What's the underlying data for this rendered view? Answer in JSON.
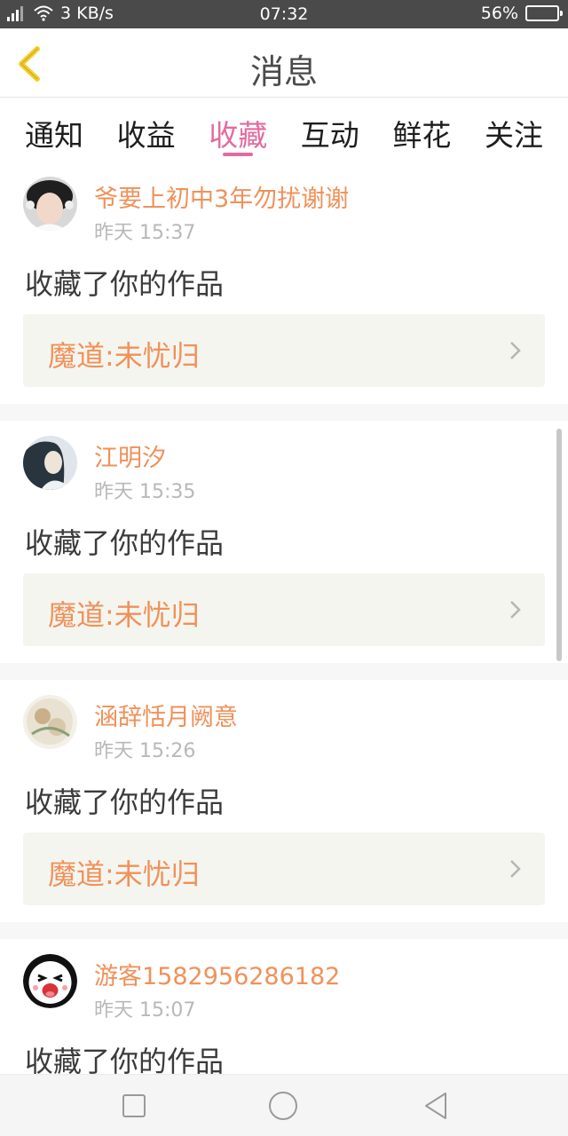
{
  "status_bar": {
    "network_speed": "3 KB/s",
    "time": "07:32",
    "battery_percent": "56%",
    "battery_level": 0.56
  },
  "header": {
    "title": "消息",
    "back_icon": "chevron-left-icon",
    "accent_color": "#f5cd2b"
  },
  "tabs": [
    {
      "label": "通知",
      "active": false
    },
    {
      "label": "收益",
      "active": false
    },
    {
      "label": "收藏",
      "active": true
    },
    {
      "label": "互动",
      "active": false
    },
    {
      "label": "鲜花",
      "active": false
    },
    {
      "label": "关注",
      "active": false
    }
  ],
  "messages": [
    {
      "username": "爷要上初中3年勿扰谢谢",
      "time": "昨天 15:37",
      "action": "收藏了你的作品",
      "work_title": "魔道:未忧归"
    },
    {
      "username": "江明汐",
      "time": "昨天 15:35",
      "action": "收藏了你的作品",
      "work_title": "魔道:未忧归"
    },
    {
      "username": "涵辞恬月阙意",
      "time": "昨天 15:26",
      "action": "收藏了你的作品",
      "work_title": "魔道:未忧归"
    },
    {
      "username": "游客1582956286182",
      "time": "昨天 15:07",
      "action": "收藏了你的作品",
      "work_title": ""
    }
  ],
  "colors": {
    "active_tab": "#e46a9f",
    "username": "#f0915a",
    "work_title": "#f0915a",
    "status_bar_bg": "#4a4a4a"
  },
  "nav_bar": {
    "recents_icon": "square-icon",
    "home_icon": "circle-icon",
    "back_icon": "triangle-back-icon"
  }
}
